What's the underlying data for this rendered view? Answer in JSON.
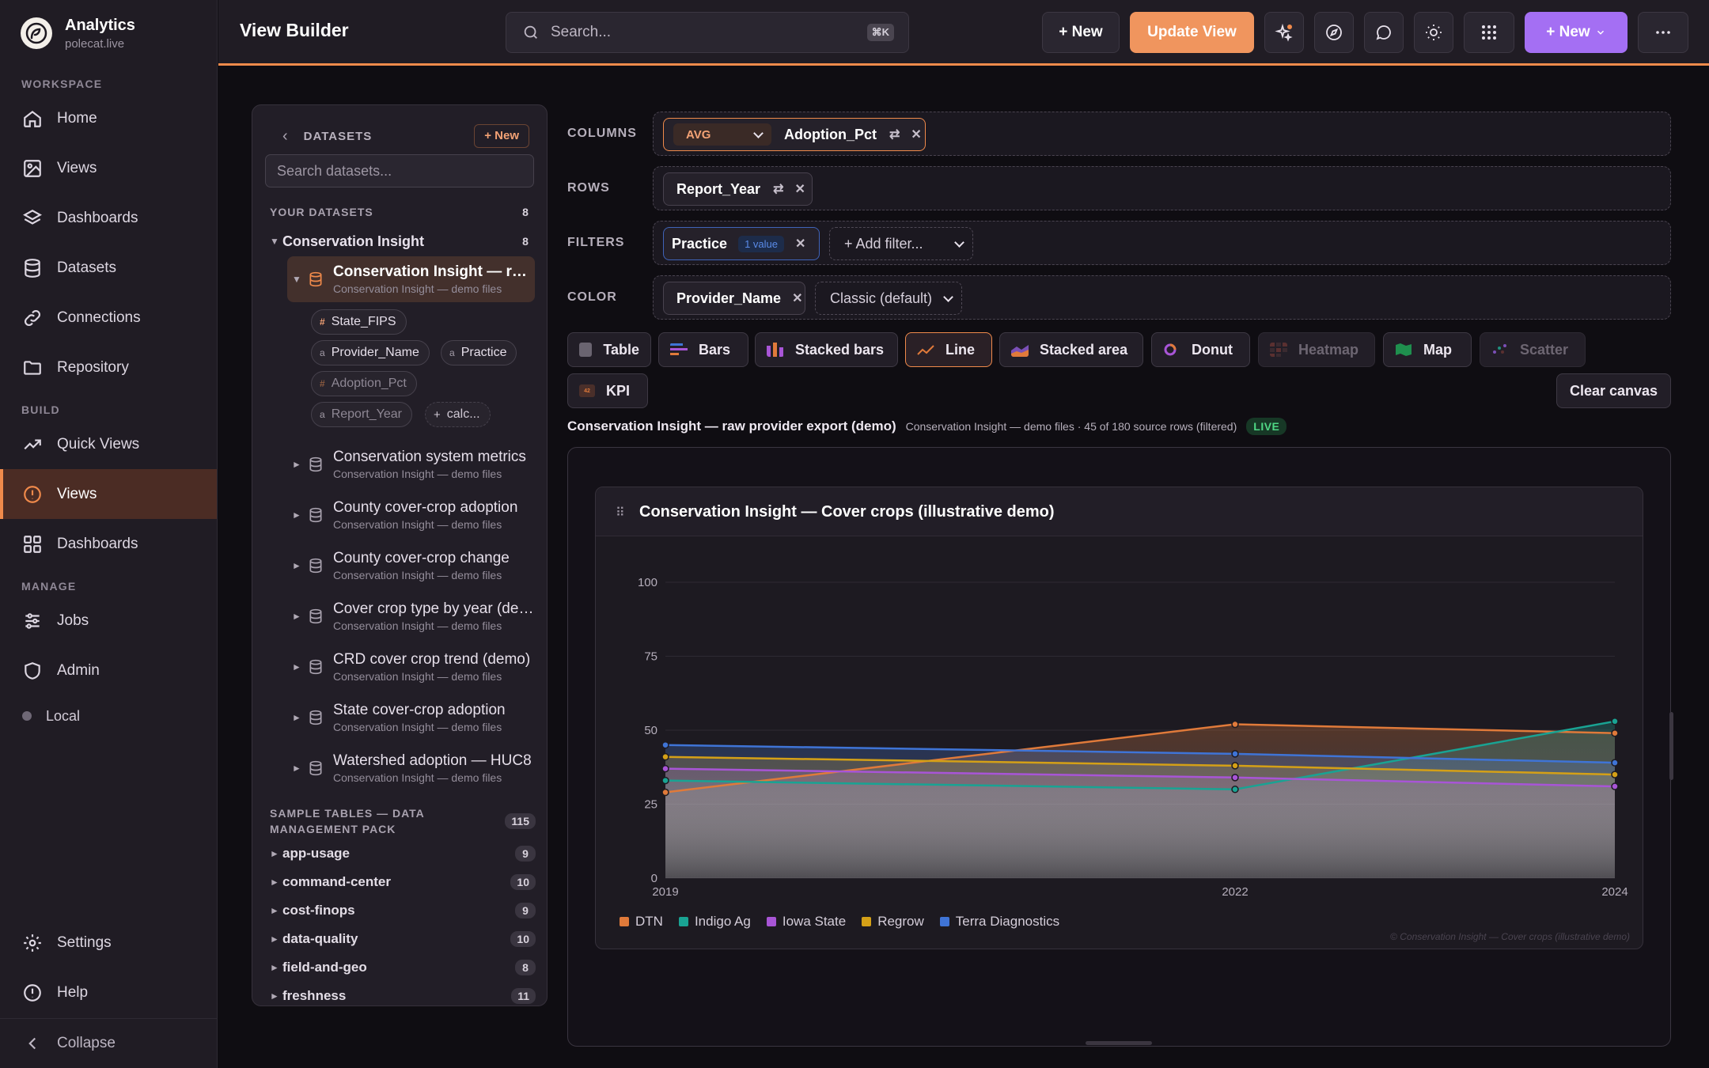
{
  "brand": {
    "name": "Analytics",
    "host": "polecat.live"
  },
  "sidebar": {
    "workspace_label": "WORKSPACE",
    "build_label": "BUILD",
    "manage_label": "MANAGE",
    "workspace": [
      {
        "label": "Home",
        "icon": "home-icon"
      },
      {
        "label": "Views",
        "icon": "image-icon"
      },
      {
        "label": "Dashboards",
        "icon": "layers-icon"
      },
      {
        "label": "Datasets",
        "icon": "database-icon"
      },
      {
        "label": "Connections",
        "icon": "link-icon"
      },
      {
        "label": "Repository",
        "icon": "folder-icon"
      }
    ],
    "build": [
      {
        "label": "Quick Views",
        "icon": "trend-icon"
      },
      {
        "label": "Views",
        "icon": "alert-circle-icon",
        "active": true
      },
      {
        "label": "Dashboards",
        "icon": "grid-icon"
      }
    ],
    "manage": [
      {
        "label": "Jobs",
        "icon": "sliders-icon"
      },
      {
        "label": "Admin",
        "icon": "shield-icon"
      }
    ],
    "local": "Local",
    "settings": "Settings",
    "help": "Help",
    "collapse": "Collapse"
  },
  "topbar": {
    "title": "View Builder",
    "search_placeholder": "Search...",
    "shortcut": "⌘K",
    "new_label": "+ New",
    "update_label": "Update View",
    "new_menu_label": "+ New"
  },
  "datasets_panel": {
    "title": "DATASETS",
    "new_label": "+ New",
    "search_placeholder": "Search datasets...",
    "your_datasets_label": "YOUR DATASETS",
    "your_datasets_count": "8",
    "group": {
      "name": "Conservation Insight",
      "count": "8"
    },
    "items": [
      {
        "name": "Conservation Insight — raw provider export (demo)",
        "sub": "Conservation Insight — demo files"
      },
      {
        "name": "Conservation system metrics",
        "sub": "Conservation Insight — demo files"
      },
      {
        "name": "County cover-crop adoption",
        "sub": "Conservation Insight — demo files"
      },
      {
        "name": "County cover-crop change",
        "sub": "Conservation Insight — demo files"
      },
      {
        "name": "Cover crop type by year (demo)",
        "sub": "Conservation Insight — demo files"
      },
      {
        "name": "CRD cover crop trend (demo)",
        "sub": "Conservation Insight — demo files"
      },
      {
        "name": "State cover-crop adoption",
        "sub": "Conservation Insight — demo files"
      },
      {
        "name": "Watershed adoption — HUC8",
        "sub": "Conservation Insight — demo files"
      }
    ],
    "fields": [
      {
        "type": "#",
        "name": "State_FIPS"
      },
      {
        "type": "a",
        "name": "Provider_Name"
      },
      {
        "type": "a",
        "name": "Practice"
      },
      {
        "type": "#",
        "name": "Adoption_Pct"
      },
      {
        "type": "a",
        "name": "Report_Year"
      },
      {
        "type": "+",
        "name": "calc..."
      }
    ],
    "sample_label": "SAMPLE TABLES — DATA MANAGEMENT PACK",
    "sample_count": "115",
    "samples": [
      {
        "name": "app-usage",
        "count": "9"
      },
      {
        "name": "command-center",
        "count": "10"
      },
      {
        "name": "cost-finops",
        "count": "9"
      },
      {
        "name": "data-quality",
        "count": "10"
      },
      {
        "name": "field-and-geo",
        "count": "8"
      },
      {
        "name": "freshness",
        "count": "11"
      }
    ]
  },
  "shelves": {
    "columns_label": "COLUMNS",
    "rows_label": "ROWS",
    "filters_label": "FILTERS",
    "color_label": "COLOR",
    "columns_agg": "AVG",
    "columns_field": "Adoption_Pct",
    "rows_field": "Report_Year",
    "filter_field": "Practice",
    "filter_badge": "1 value",
    "add_filter": "+ Add filter...",
    "color_field": "Provider_Name",
    "palette": "Classic (default)"
  },
  "viz_types": [
    "Table",
    "Bars",
    "Stacked bars",
    "Line",
    "Stacked area",
    "Donut",
    "Heatmap",
    "Map",
    "Scatter",
    "KPI"
  ],
  "active_viz": "Line",
  "clear_canvas": "Clear canvas",
  "context": {
    "dataset": "Conservation Insight — raw provider export (demo)",
    "detail": "Conservation Insight — demo files · 45 of 180 source rows (filtered)",
    "status": "LIVE"
  },
  "card": {
    "title": "Conservation Insight — Cover crops (illustrative demo)",
    "watermark": "© Conservation Insight — Cover crops (illustrative demo)"
  },
  "chart_data": {
    "type": "line",
    "title": "Conservation Insight — Cover crops (illustrative demo)",
    "x": [
      2019,
      2022,
      2024
    ],
    "ylim": [
      0,
      100
    ],
    "yticks": [
      0,
      25,
      50,
      75,
      100
    ],
    "series": [
      {
        "name": "DTN",
        "color": "#e07a3a",
        "values": [
          29,
          52,
          49
        ]
      },
      {
        "name": "Indigo Ag",
        "color": "#19a393",
        "values": [
          33,
          30,
          53
        ]
      },
      {
        "name": "Iowa State",
        "color": "#a855d6",
        "values": [
          37,
          34,
          31
        ]
      },
      {
        "name": "Regrow",
        "color": "#d4a017",
        "values": [
          41,
          38,
          35
        ]
      },
      {
        "name": "Terra Diagnostics",
        "color": "#3f74d6",
        "values": [
          45,
          42,
          39
        ]
      }
    ],
    "legend": "bottom-left",
    "grid": true
  }
}
